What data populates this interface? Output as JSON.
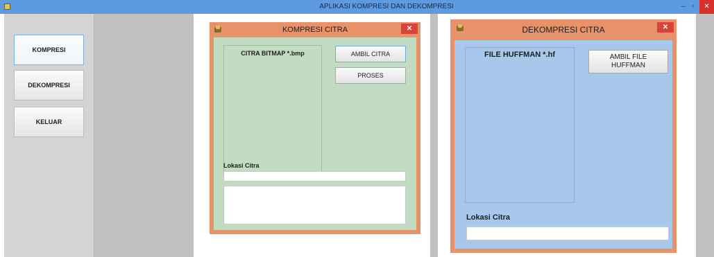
{
  "main_window": {
    "title": "APLIKASI KOMPRESI DAN DEKOMPRESI",
    "controls": {
      "minimize": "–",
      "maximize": "▫",
      "close": "✕"
    }
  },
  "sidebar": {
    "buttons": [
      {
        "label": "KOMPRESI"
      },
      {
        "label": "DEKOMPRESI"
      },
      {
        "label": "KELUAR"
      }
    ]
  },
  "kompresi": {
    "title": "KOMPRESI CITRA",
    "close": "✕",
    "preview_label": "CITRA BITMAP *.bmp",
    "btn_ambil": "AMBIL CITRA",
    "btn_proses": "PROSES",
    "lokasi_label": "Lokasi Citra",
    "lokasi_value": "",
    "output_value": ""
  },
  "dekompresi": {
    "title": "DEKOMPRESI CITRA",
    "close": "✕",
    "preview_label": "FILE HUFFMAN *.hf",
    "btn_ambil": "AMBIL FILE\nHUFFMAN",
    "lokasi_label": "Lokasi Citra",
    "lokasi_value": ""
  }
}
